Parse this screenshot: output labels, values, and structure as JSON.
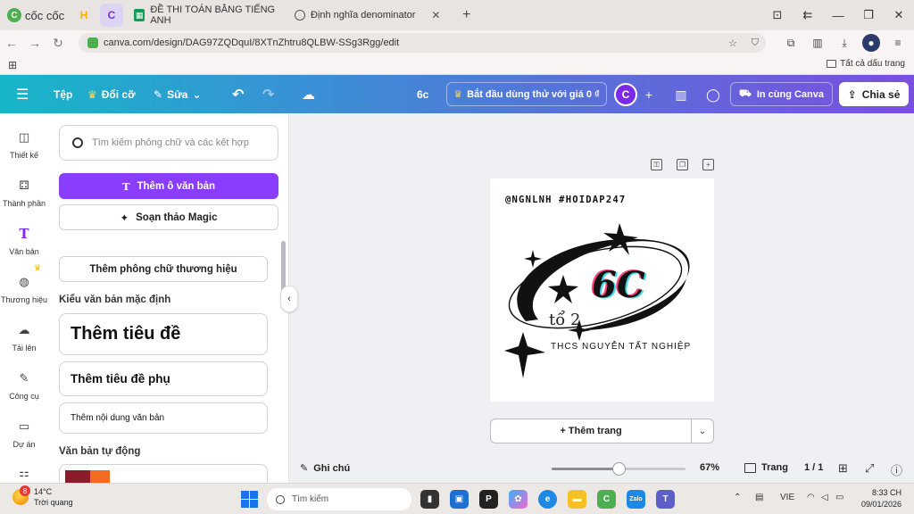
{
  "browser": {
    "brand": "cốc cốc",
    "tabs": [
      {
        "title": "ĐỀ THI TOÁN BẰNG TIẾNG ANH"
      },
      {
        "title": "Định nghĩa denominator"
      }
    ],
    "url": "canva.com/design/DAG97ZQDquI/8XTnZhtru8QLBW-SSg3Rgg/edit",
    "bookmarks_all": "Tất cả dấu trang"
  },
  "toolbar": {
    "file": "Tệp",
    "resize": "Đổi cỡ",
    "edit": "Sửa",
    "design_title": "6c",
    "trial": "Bắt đầu dùng thử với giá 0 ₫",
    "user_initial": "C",
    "print": "In cùng Canva",
    "share": "Chia sẻ"
  },
  "rail": [
    {
      "label": "Thiết kế",
      "icon": "layout-icon"
    },
    {
      "label": "Thành phần",
      "icon": "elements-icon"
    },
    {
      "label": "Văn bản",
      "icon": "text-icon"
    },
    {
      "label": "Thương hiệu",
      "icon": "brand-icon"
    },
    {
      "label": "Tải lên",
      "icon": "upload-icon"
    },
    {
      "label": "Công cụ",
      "icon": "tools-icon"
    },
    {
      "label": "Dự án",
      "icon": "folder-icon"
    }
  ],
  "panel": {
    "search_placeholder": "Tìm kiếm phông chữ và các kết hợp",
    "add_textbox": "Thêm ô văn bản",
    "magic_write": "Soạn thảo Magic",
    "brand_fonts": "Thêm phông chữ thương hiệu",
    "default_styles_title": "Kiểu văn bản mặc định",
    "heading": "Thêm tiêu đề",
    "subheading": "Thêm tiêu đề phụ",
    "body": "Thêm nội dung văn bản",
    "auto_text_title": "Văn bản tự động"
  },
  "design": {
    "handle": "@NGNLNH #HOIDAP247",
    "class_name": "6C",
    "group": "tổ 2",
    "school": "THCS NGUYỄN TẤT NGHIỆP"
  },
  "canvas": {
    "add_page": "+ Thêm trang"
  },
  "footer": {
    "notes": "Ghi chú",
    "zoom_percent": "67%",
    "zoom_fraction": 0.5,
    "pages_label": "Trang",
    "page_count": "1 / 1"
  },
  "taskbar": {
    "temperature": "14°C",
    "weather": "Trời quang",
    "weather_badge": "8",
    "search_placeholder": "Tìm kiếm",
    "language": "VIE",
    "time": "8:33 CH",
    "date": "09/01/2026"
  },
  "colors": {
    "accent": "#8b3dff",
    "toolbar_start": "#17b6c9",
    "toolbar_end": "#7a4fe0"
  }
}
